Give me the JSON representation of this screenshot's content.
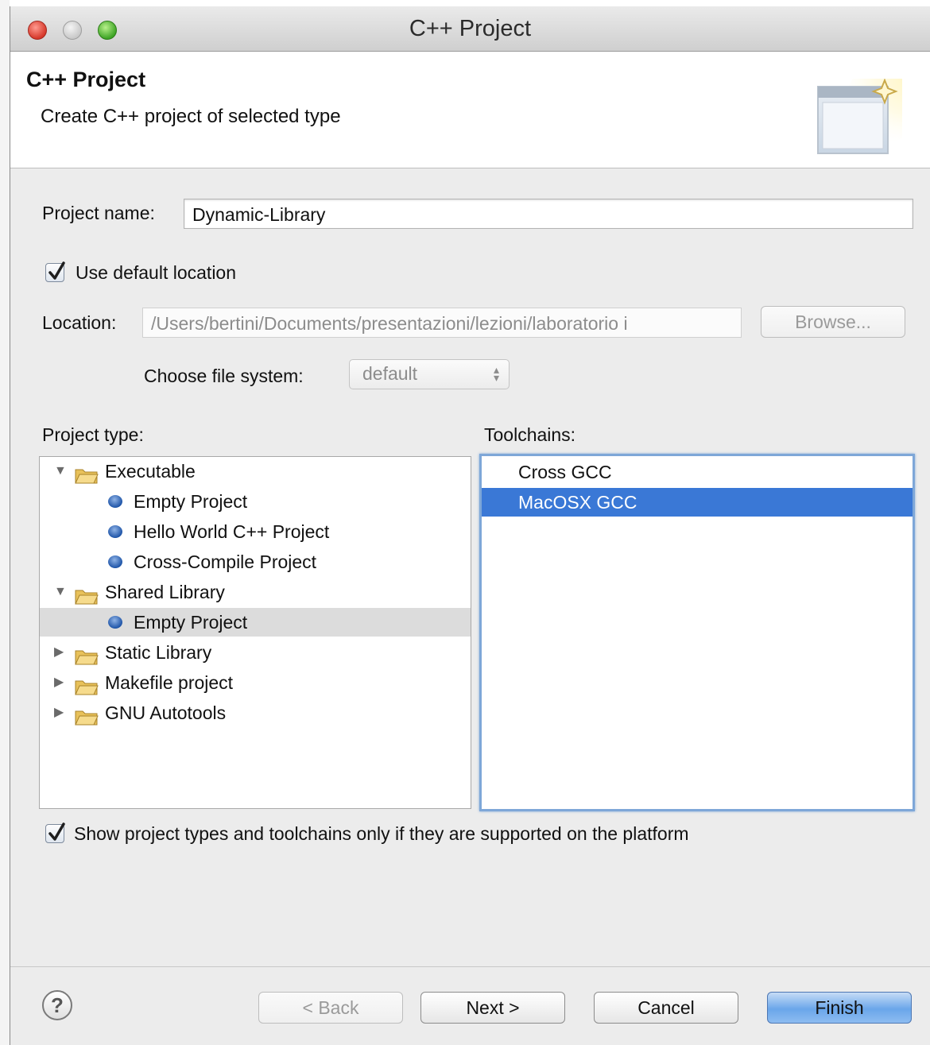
{
  "window": {
    "title": "C++ Project"
  },
  "header": {
    "title": "C++ Project",
    "description": "Create C++ project of selected type"
  },
  "form": {
    "project_name_label": "Project name:",
    "project_name_value": "Dynamic-Library",
    "use_default_location_label": "Use default location",
    "use_default_location_checked": true,
    "location_label": "Location:",
    "location_value": "/Users/bertini/Documents/presentazioni/lezioni/laboratorio i",
    "browse_label": "Browse...",
    "file_system_label": "Choose file system:",
    "file_system_value": "default"
  },
  "project_type": {
    "label": "Project type:",
    "items": [
      {
        "label": "Executable",
        "kind": "folder",
        "expanded": true
      },
      {
        "label": "Empty Project",
        "kind": "leaf"
      },
      {
        "label": "Hello World C++ Project",
        "kind": "leaf"
      },
      {
        "label": "Cross-Compile Project",
        "kind": "leaf"
      },
      {
        "label": "Shared Library",
        "kind": "folder",
        "expanded": true
      },
      {
        "label": "Empty Project",
        "kind": "leaf",
        "selected": true
      },
      {
        "label": "Static Library",
        "kind": "folder",
        "expanded": false
      },
      {
        "label": "Makefile project",
        "kind": "folder",
        "expanded": false
      },
      {
        "label": "GNU Autotools",
        "kind": "folder",
        "expanded": false
      }
    ]
  },
  "toolchains": {
    "label": "Toolchains:",
    "items": [
      {
        "label": "Cross GCC"
      },
      {
        "label": "MacOSX GCC",
        "selected": true
      }
    ]
  },
  "filter": {
    "label": "Show project types and toolchains only if they are supported on the platform",
    "checked": true
  },
  "buttons": {
    "help": "?",
    "back": "< Back",
    "next": "Next >",
    "cancel": "Cancel",
    "finish": "Finish"
  },
  "colors": {
    "selection_blue": "#3a78d6",
    "selection_gray": "#dcdcdc",
    "default_button": "#6aa6ea"
  }
}
